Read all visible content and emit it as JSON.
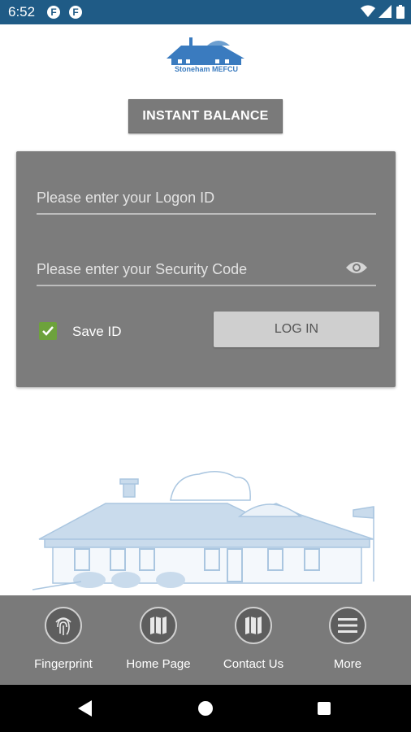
{
  "status_bar": {
    "time": "6:52",
    "notification_icons": [
      "f-app-icon",
      "f-app-icon"
    ],
    "icons": [
      "wifi-icon",
      "cell-signal-icon",
      "battery-icon"
    ]
  },
  "logo": {
    "text": "Stoneham MEFCU",
    "icon": "credit-union-building-logo"
  },
  "instant_balance": {
    "label": "INSTANT BALANCE"
  },
  "login_form": {
    "logon_id": {
      "value": "",
      "placeholder": "Please enter your Logon ID"
    },
    "security_code": {
      "value": "",
      "placeholder": "Please enter your Security Code",
      "icon": "eye-icon"
    },
    "save_id": {
      "label": "Save ID",
      "checked": true
    },
    "login_button": {
      "label": "LOG IN"
    }
  },
  "illustration": {
    "icon": "building-illustration"
  },
  "bottom_nav": {
    "items": [
      {
        "label": "Fingerprint",
        "icon": "fingerprint-icon"
      },
      {
        "label": "Home Page",
        "icon": "map-icon"
      },
      {
        "label": "Contact Us",
        "icon": "map-icon"
      },
      {
        "label": "More",
        "icon": "menu-icon"
      }
    ]
  },
  "system_nav": {
    "icons": [
      "back-icon",
      "home-icon",
      "recents-icon"
    ]
  },
  "colors": {
    "status_bar": "#1f5b86",
    "card": "#7c7c7c",
    "checkbox": "#6da23c",
    "login_button": "#cfcfcf",
    "bottom_bar": "#7a7a7a",
    "logo_blue": "#3a7bbf",
    "illustration": "#b8d0e6"
  }
}
